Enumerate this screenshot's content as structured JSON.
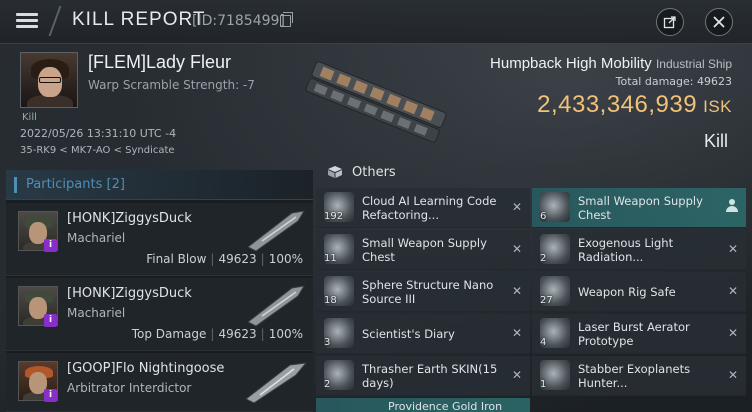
{
  "header": {
    "title": "KILL REPORT",
    "report_id": "[ID:7185499]"
  },
  "victim": {
    "name": "[FLEM]Lady Fleur",
    "warp_scramble": "Warp Scramble Strength: -7",
    "tag": "Kill",
    "datetime": "2022/05/26 13:31:10 UTC -4",
    "location": "35-RK9 < MK7-AO < Syndicate"
  },
  "ship": {
    "name": "Humpback High Mobility",
    "class": "Industrial Ship",
    "total_damage_label": "Total damage:",
    "total_damage": "49623",
    "isk_value": "2,433,346,939",
    "isk_unit": "ISK",
    "result": "Kill"
  },
  "participants": {
    "label": "Participants [2]",
    "list": [
      {
        "name": "[HONK]ZiggysDuck",
        "ship": "Machariel",
        "role": "Final Blow",
        "damage": "49623",
        "percent": "100%"
      },
      {
        "name": "[HONK]ZiggysDuck",
        "ship": "Machariel",
        "role": "Top Damage",
        "damage": "49623",
        "percent": "100%"
      },
      {
        "name": "[GOOP]Flo Nightingoose",
        "ship": "Arbitrator Interdictor",
        "role": "",
        "damage": "",
        "percent": ""
      }
    ]
  },
  "items": {
    "section_label": "Others",
    "left": [
      {
        "qty": "192",
        "name": "Cloud AI Learning Code Refactoring..."
      },
      {
        "qty": "11",
        "name": "Small Weapon Supply Chest"
      },
      {
        "qty": "18",
        "name": "Sphere Structure Nano Source III"
      },
      {
        "qty": "3",
        "name": "Scientist's Diary"
      },
      {
        "qty": "2",
        "name": "Thrasher Earth SKIN(15 days)"
      }
    ],
    "left_partial": "Providence Gold Iron",
    "right": [
      {
        "qty": "6",
        "name": "Small Weapon Supply Chest",
        "highlight": true
      },
      {
        "qty": "2",
        "name": "Exogenous Light Radiation..."
      },
      {
        "qty": "27",
        "name": "Weapon Rig Safe"
      },
      {
        "qty": "4",
        "name": "Laser Burst Aerator Prototype"
      },
      {
        "qty": "1",
        "name": "Stabber Exoplanets Hunter..."
      }
    ]
  },
  "icons": {
    "menu": "hamburger-icon",
    "copy": "copy-icon",
    "share": "share-icon",
    "close": "close-icon",
    "info": "info-badge-icon",
    "remove": "close-x-icon",
    "owner": "person-icon"
  },
  "colors": {
    "isk": "#f0c27a",
    "participants_accent": "#4f8fb5",
    "highlight": "#2d6e6e",
    "info_badge": "#8a2ec9"
  }
}
